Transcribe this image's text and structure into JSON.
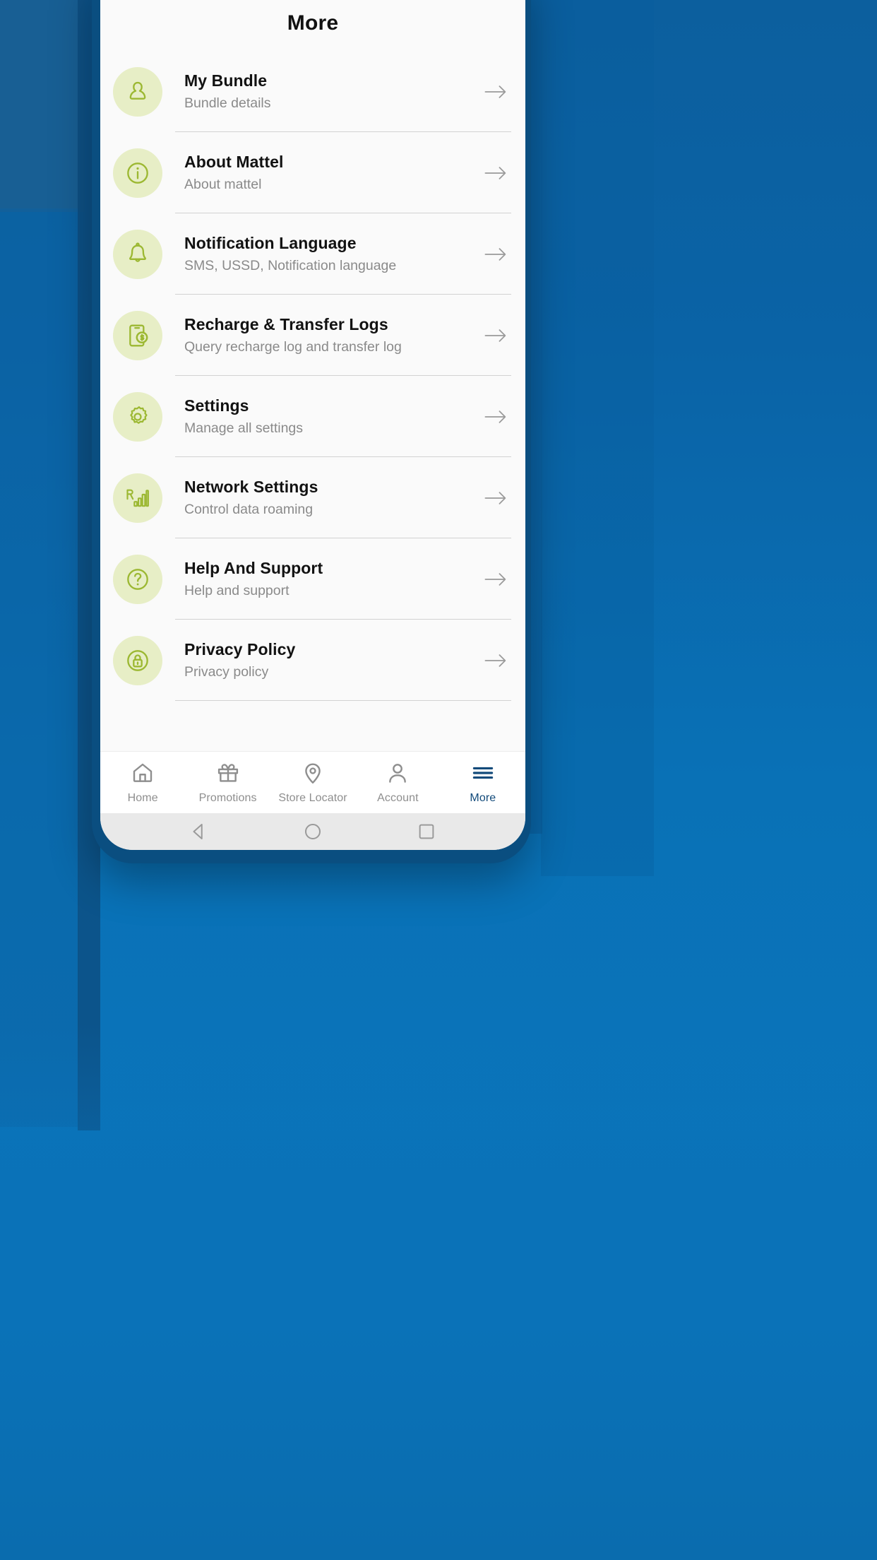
{
  "header": {
    "title": "More"
  },
  "menu": {
    "items": [
      {
        "icon": "person-icon",
        "title": "My Bundle",
        "subtitle": "Bundle details"
      },
      {
        "icon": "info-circle-icon",
        "title": "About Mattel",
        "subtitle": "About mattel"
      },
      {
        "icon": "bell-icon",
        "title": "Notification Language",
        "subtitle": "SMS, USSD, Notification language"
      },
      {
        "icon": "phone-money-icon",
        "title": "Recharge & Transfer Logs",
        "subtitle": "Query recharge log and transfer log"
      },
      {
        "icon": "gear-icon",
        "title": "Settings",
        "subtitle": "Manage all settings"
      },
      {
        "icon": "roaming-signal-icon",
        "title": "Network Settings",
        "subtitle": "Control data roaming"
      },
      {
        "icon": "question-circle-icon",
        "title": "Help And Support",
        "subtitle": "Help and support"
      },
      {
        "icon": "lock-icon",
        "title": "Privacy Policy",
        "subtitle": "Privacy policy"
      }
    ],
    "arrow_icon": "arrow-right-icon"
  },
  "tabbar": {
    "tabs": [
      {
        "icon": "home-icon",
        "label": "Home",
        "active": false
      },
      {
        "icon": "gift-icon",
        "label": "Promotions",
        "active": false
      },
      {
        "icon": "map-pin-icon",
        "label": "Store Locator",
        "active": false
      },
      {
        "icon": "account-icon",
        "label": "Account",
        "active": false
      },
      {
        "icon": "hamburger-icon",
        "label": "More",
        "active": true
      }
    ]
  },
  "system_nav": {
    "back_icon": "triangle-back-icon",
    "home_icon": "circle-home-icon",
    "recents_icon": "square-recents-icon"
  },
  "colors": {
    "background_blue": "#0a6cae",
    "icon_badge_bg": "#e7eec6",
    "icon_green": "#9cb832",
    "title_text": "#121212",
    "subtitle_text": "#8a8a8a",
    "active_tab": "#124a7a"
  }
}
